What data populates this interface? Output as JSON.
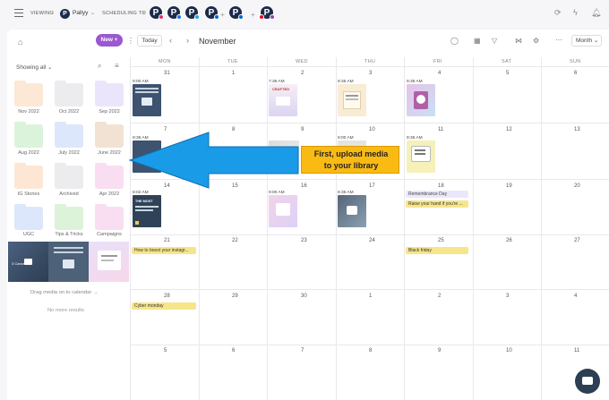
{
  "topbar": {
    "viewing_label": "VIEWING",
    "workspace_name": "Pallyy",
    "scheduling_label": "SCHEDULING TO",
    "logo_letter": "P",
    "profiles": [
      {
        "letter": "P",
        "network": "instagram",
        "color": "#e1306c"
      },
      {
        "letter": "P",
        "network": "facebook",
        "color": "#1877f2"
      },
      {
        "letter": "P",
        "network": "twitter",
        "color": "#1da1f2"
      },
      {
        "letter": "P",
        "network": "linkedin",
        "color": "#0a66c2"
      },
      {
        "letter": "P",
        "network": "linkedin",
        "color": "#0a66c2"
      },
      {
        "letter": "P",
        "network": "pinterest",
        "color": "#e60023"
      }
    ]
  },
  "sidebar": {
    "filter_label": "Showing all",
    "folders": [
      {
        "label": "Nov 2022",
        "color": "#fde8d6"
      },
      {
        "label": "Oct 2022",
        "color": "#ececef"
      },
      {
        "label": "Sep 2022",
        "color": "#ebe5fb"
      },
      {
        "label": "Aug 2022",
        "color": "#dbf3da"
      },
      {
        "label": "July 2022",
        "color": "#dde7fb"
      },
      {
        "label": "June 2022",
        "color": "#f2e2d3"
      },
      {
        "label": "IG Stories",
        "color": "#fde6d3"
      },
      {
        "label": "Archived",
        "color": "#ececef"
      },
      {
        "label": "Apr 2022",
        "color": "#f8def0"
      },
      {
        "label": "UGC",
        "color": "#dde7fb"
      },
      {
        "label": "Tips & Tricks",
        "color": "#dcf3d9"
      },
      {
        "label": "Campaigns",
        "color": "#f8def0"
      }
    ],
    "thumb_caption": "3 Cancer",
    "drag_hint": "Drag media on to calendar",
    "no_more": "No more results"
  },
  "toolbar": {
    "new_label": "New +",
    "today_label": "Today",
    "month_title": "November",
    "view_select": "Month"
  },
  "calendar": {
    "weekdays": [
      "MON",
      "TUE",
      "WED",
      "THU",
      "FRI",
      "SAT",
      "SUN"
    ],
    "weeks": [
      [
        "31",
        "1",
        "2",
        "3",
        "4",
        "5",
        "6"
      ],
      [
        "7",
        "8",
        "9",
        "10",
        "11",
        "12",
        "13"
      ],
      [
        "14",
        "15",
        "16",
        "17",
        "18",
        "19",
        "20"
      ],
      [
        "21",
        "22",
        "23",
        "24",
        "25",
        "26",
        "27"
      ],
      [
        "28",
        "29",
        "30",
        "1",
        "2",
        "3",
        "4"
      ],
      [
        "5",
        "6",
        "7",
        "8",
        "9",
        "10",
        "11"
      ]
    ],
    "post_times": {
      "w1_mon": "9:00 AM",
      "w1_wed": "7:35 AM",
      "w1_thu": "8:35 AM",
      "w1_fri": "9:35 AM",
      "w2_mon": "9:35 AM",
      "w2_thu": "9:00 AM",
      "w2_fri": "9:35 AM",
      "w3_mon": "8:02 AM",
      "w3_wed": "9:00 AM",
      "w3_thu": "8:35 AM"
    },
    "chips": {
      "remembrance": "Remembrance Day",
      "raise_hand": "Raise your hand if you're ...",
      "boost": "How to boost your instagr...",
      "black_friday": "Black friday",
      "cyber_monday": "Cyber monday"
    },
    "post_text": {
      "crafted": "CRAFTED",
      "the_most": "THE MOST"
    }
  },
  "callout": {
    "line1": "First, upload media",
    "line2": "to your library"
  }
}
